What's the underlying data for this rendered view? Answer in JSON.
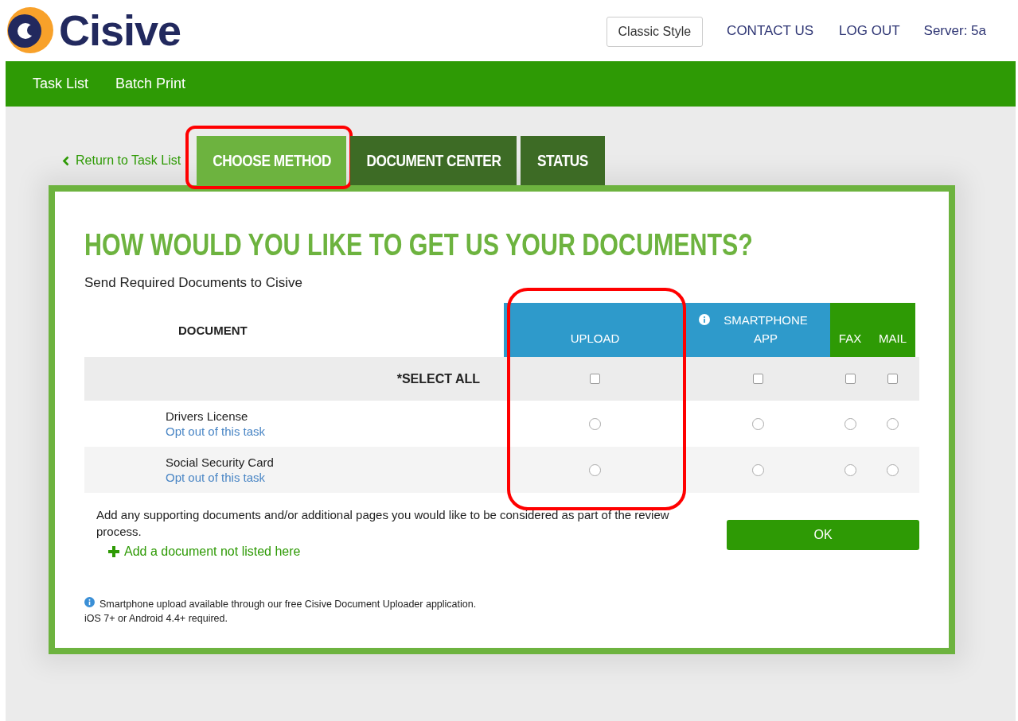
{
  "header": {
    "logo": "Cisive",
    "style_button": "Classic Style",
    "links": [
      "CONTACT US",
      "LOG OUT"
    ],
    "server": "Server: 5a"
  },
  "nav": {
    "items": [
      "Task List",
      "Batch Print"
    ]
  },
  "back_link": "Return to Task List",
  "tabs": [
    {
      "label": "CHOOSE METHOD",
      "selected": true,
      "highlighted": true
    },
    {
      "label": "DOCUMENT CENTER",
      "selected": false,
      "highlighted": false
    },
    {
      "label": "STATUS",
      "selected": false,
      "highlighted": false
    }
  ],
  "card": {
    "title": "HOW WOULD YOU LIKE TO GET US YOUR DOCUMENTS?",
    "subtitle": "Send Required Documents to Cisive",
    "table": {
      "document_heading": "DOCUMENT",
      "columns": [
        {
          "label": "UPLOAD",
          "color": "#2e9acb",
          "info_icon": false,
          "highlighted": true
        },
        {
          "label": "SMARTPHONE APP",
          "color": "#2e9acb",
          "info_icon": true,
          "highlighted": false
        },
        {
          "label": "FAX",
          "color": "#2e9a05",
          "info_icon": false,
          "highlighted": false
        },
        {
          "label": "MAIL",
          "color": "#2e9a05",
          "info_icon": false,
          "highlighted": false
        }
      ],
      "select_all": {
        "label": "*SELECT ALL",
        "checks": [
          {
            "checked": false
          },
          {
            "checked": false
          },
          {
            "checked": false
          },
          {
            "checked": false
          }
        ]
      },
      "rows": [
        {
          "document": "Drivers License",
          "opt_out": "Opt out of this task",
          "choices": [
            {
              "selected": false
            },
            {
              "selected": false
            },
            {
              "selected": false
            },
            {
              "selected": false
            }
          ]
        },
        {
          "document": "Social Security Card",
          "opt_out": "Opt out of this task",
          "choices": [
            {
              "selected": false
            },
            {
              "selected": false
            },
            {
              "selected": false
            },
            {
              "selected": false
            }
          ]
        }
      ]
    },
    "supporting_text": "Add any supporting documents and/or additional pages you would like to be considered as part of the review process.",
    "add_link": "Add a document not listed here",
    "ok_button": "OK",
    "footnote": [
      "Smartphone upload available through our free Cisive Document Uploader application.",
      "iOS 7+ or Android 4.4+ required."
    ]
  }
}
